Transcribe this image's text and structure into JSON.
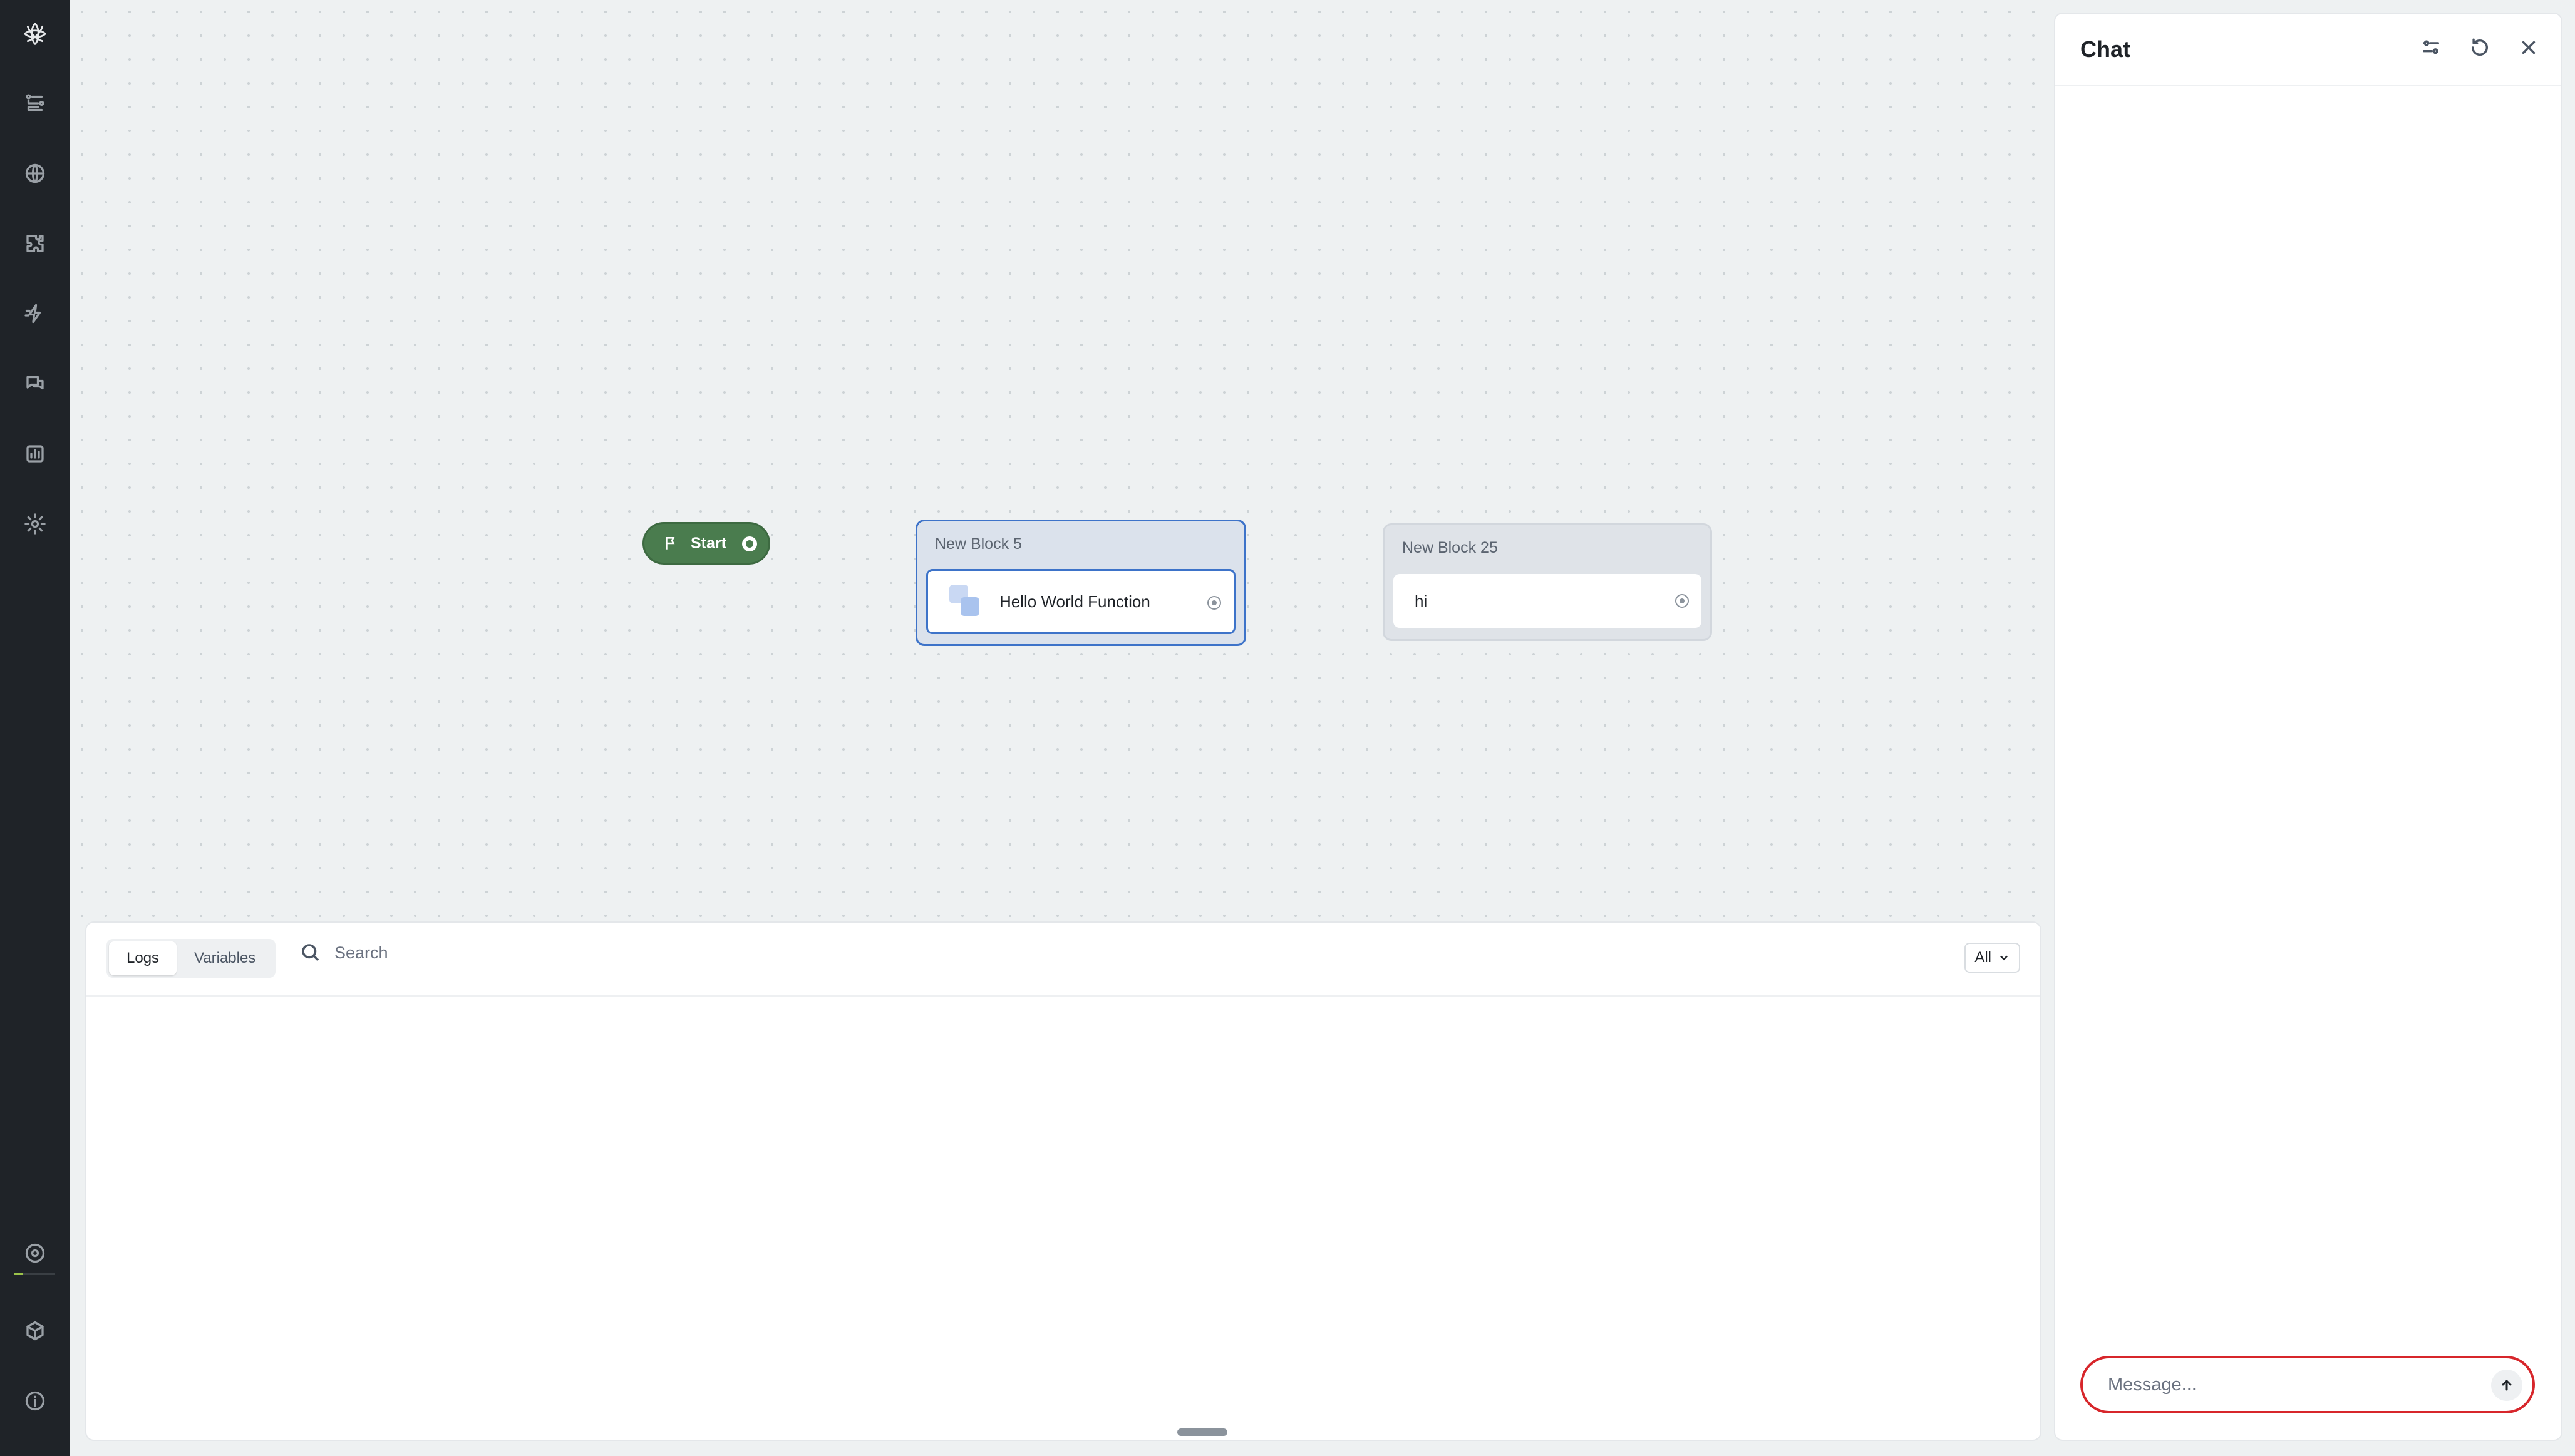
{
  "rail": {
    "icons": [
      "logo-icon",
      "flows-icon",
      "globe-icon",
      "puzzle-icon",
      "lightning-icon",
      "chat-bubbles-icon",
      "analytics-icon",
      "settings-icon",
      "target-icon",
      "cube-icon",
      "info-icon"
    ]
  },
  "canvas": {
    "start_label": "Start",
    "blocks": [
      {
        "title": "New Block 5",
        "step": "Hello World Function",
        "selected": true
      },
      {
        "title": "New Block 25",
        "step": "hi",
        "selected": false
      }
    ]
  },
  "logs": {
    "tabs": [
      "Logs",
      "Variables"
    ],
    "active_tab": "Logs",
    "search_placeholder": "Search",
    "filter_value": "All"
  },
  "chat": {
    "title": "Chat",
    "message_placeholder": "Message..."
  },
  "colors": {
    "start_node": "#4a7c4e",
    "selected_block_border": "#3d73c9",
    "message_box_border": "#d7262b",
    "rail_bg": "#1f2328"
  }
}
